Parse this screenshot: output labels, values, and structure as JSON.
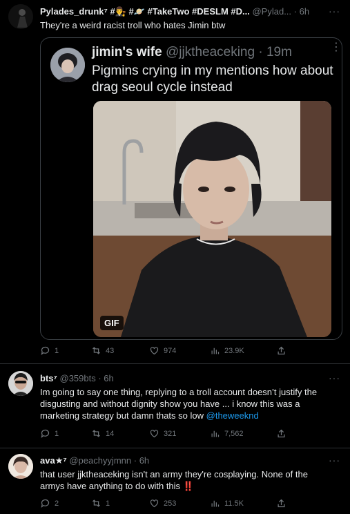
{
  "tweet1": {
    "display_name": "Pylades_drunk⁷ #👨‍⚖️ #🪐 #TakeTwo #DESLM #D...",
    "handle": "@Pylad...",
    "time": "· 6h",
    "text": "They're a weird racist troll who hates Jimin btw",
    "quoted": {
      "display_name": "jimin's wife",
      "handle": "@jjktheaceking",
      "time": "· 19m",
      "text_line1": "Pigmins crying in my mentions how about",
      "text_line2": "drag seoul cycle instead",
      "media_badge": "GIF"
    },
    "replies": "1",
    "retweets": "43",
    "likes": "974",
    "views": "23.9K"
  },
  "tweet2": {
    "display_name": "bts⁷",
    "handle": "@359bts",
    "time": "· 6h",
    "text_line1": "Im going to say one thing, replying to a troll account doesn’t justify the",
    "text_line2": "disgusting and without dignity show you have ... i know this was a",
    "text_line3": "marketing strategy but damn thats so low",
    "mention": "@theweeknd",
    "replies": "1",
    "retweets": "14",
    "likes": "321",
    "views": "7,562"
  },
  "tweet3": {
    "display_name": "ava★⁷",
    "handle": "@peachyyjmnn",
    "time": "· 6h",
    "text_line1": "that user jjktheaceking isn't an army they're cosplaying. None of the",
    "text_line2": "armys have anything to do with this",
    "emoji": "‼️",
    "replies": "2",
    "retweets": "1",
    "likes": "253",
    "views": "11.5K"
  },
  "ui": {
    "more_glyph": "···"
  },
  "colors": {
    "background": "#000000",
    "text": "#e7e9ea",
    "muted": "#71767b",
    "link": "#1d9bf0",
    "divider": "#2f3336"
  }
}
